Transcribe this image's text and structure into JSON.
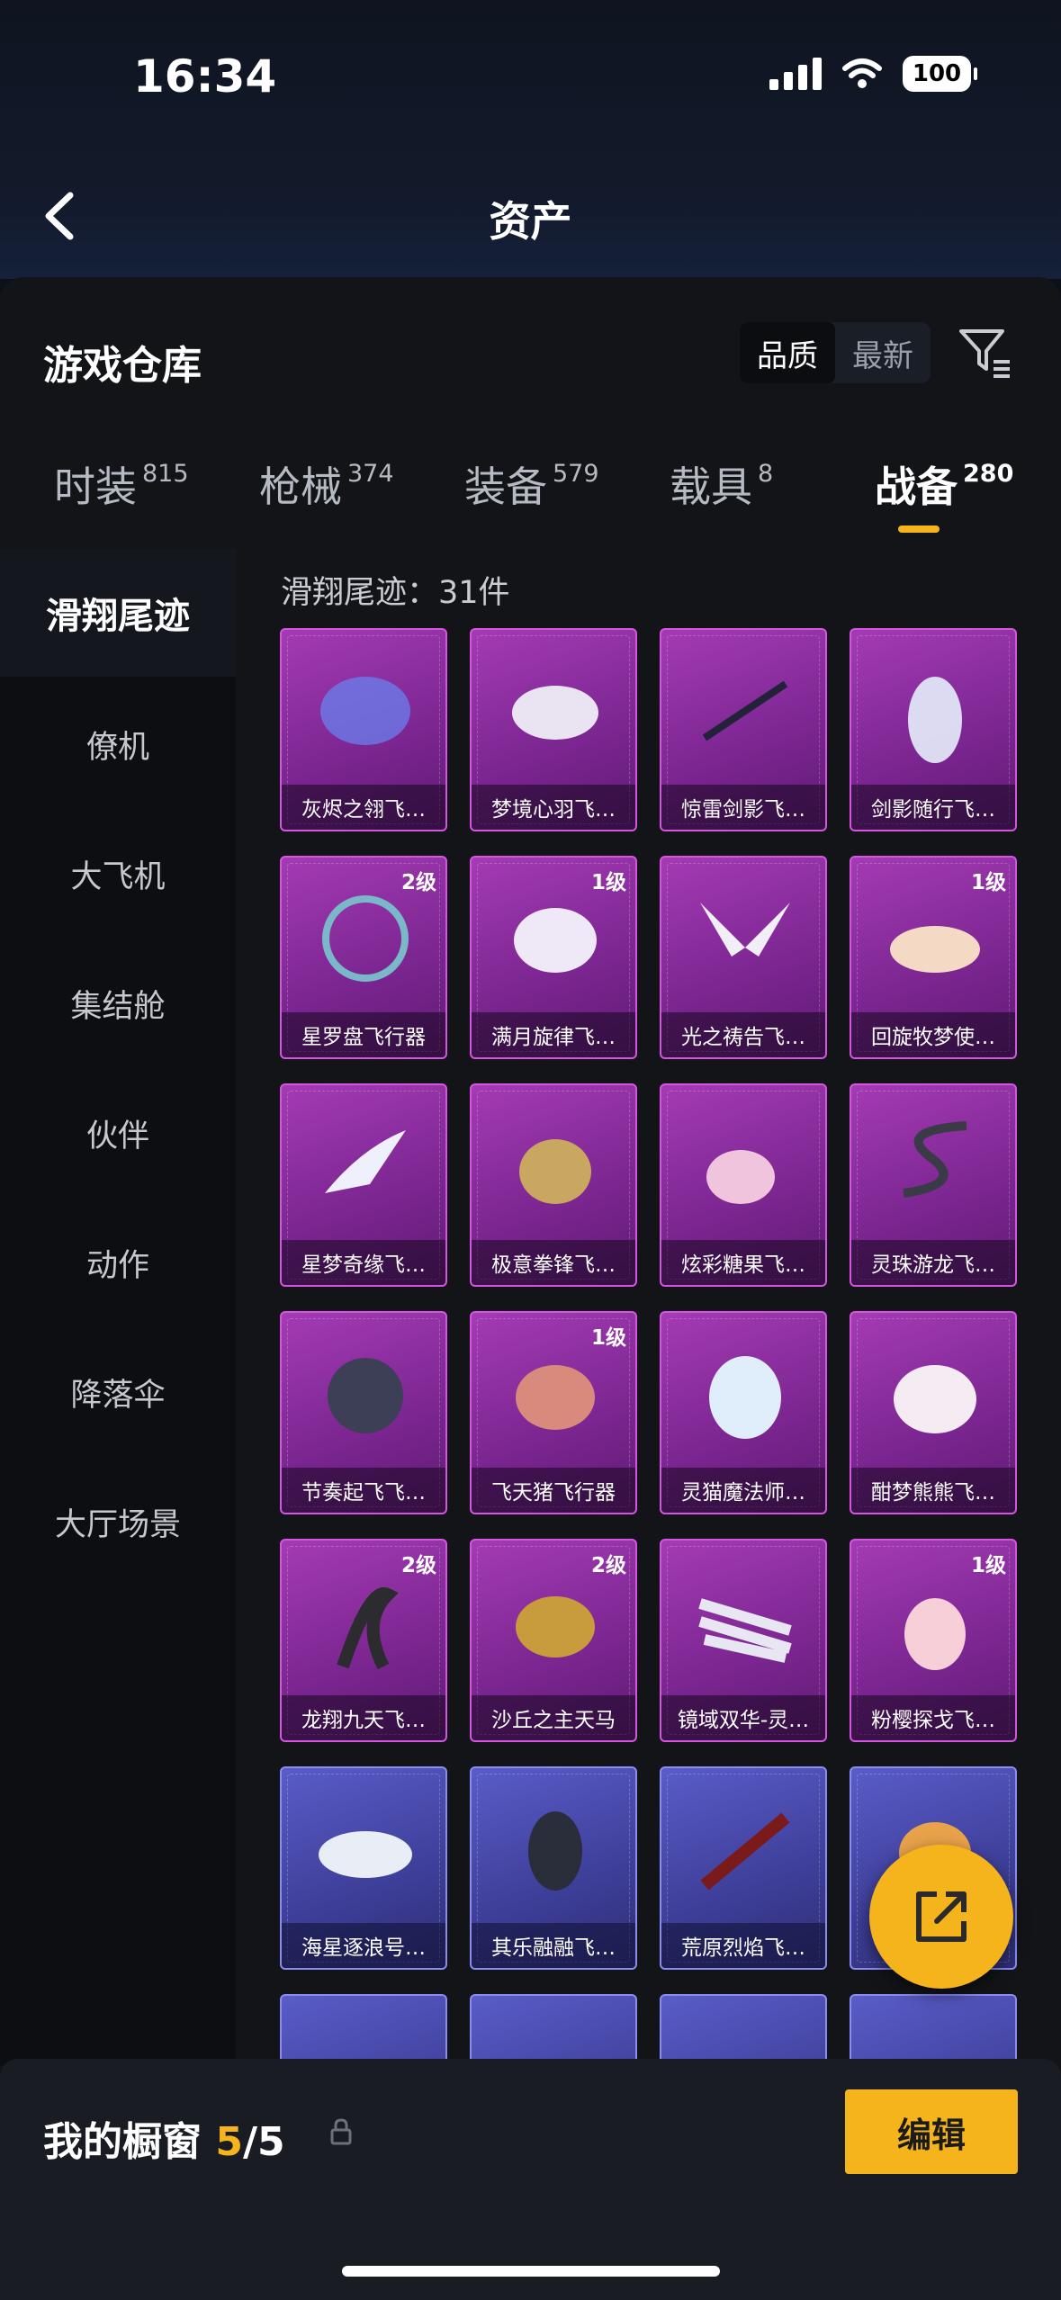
{
  "status": {
    "time": "16:34",
    "battery": "100"
  },
  "nav": {
    "title": "资产"
  },
  "warehouse": {
    "title": "游戏仓库",
    "sort_options": [
      "品质",
      "最新"
    ]
  },
  "tabs": [
    {
      "label": "时装",
      "count": "815"
    },
    {
      "label": "枪械",
      "count": "374"
    },
    {
      "label": "装备",
      "count": "579"
    },
    {
      "label": "载具",
      "count": "8"
    },
    {
      "label": "战备",
      "count": "280"
    }
  ],
  "sidebar": {
    "active": "滑翔尾迹",
    "items": [
      "僚机",
      "大飞机",
      "集结舱",
      "伙伴",
      "动作",
      "降落伞",
      "大厅场景"
    ]
  },
  "content": {
    "count_label": "滑翔尾迹：31件",
    "items": [
      {
        "name": "灰烬之翎飞…",
        "level": ""
      },
      {
        "name": "梦境心羽飞…",
        "level": ""
      },
      {
        "name": "惊雷剑影飞…",
        "level": ""
      },
      {
        "name": "剑影随行飞…",
        "level": ""
      },
      {
        "name": "星罗盘飞行器",
        "level": "2级"
      },
      {
        "name": "满月旋律飞…",
        "level": "1级"
      },
      {
        "name": "光之祷告飞…",
        "level": ""
      },
      {
        "name": "回旋牧梦使…",
        "level": "1级"
      },
      {
        "name": "星梦奇缘飞…",
        "level": ""
      },
      {
        "name": "极意拳锋飞…",
        "level": ""
      },
      {
        "name": "炫彩糖果飞…",
        "level": ""
      },
      {
        "name": "灵珠游龙飞…",
        "level": ""
      },
      {
        "name": "节奏起飞飞…",
        "level": ""
      },
      {
        "name": "飞天猪飞行器",
        "level": "1级"
      },
      {
        "name": "灵猫魔法师…",
        "level": ""
      },
      {
        "name": "酣梦熊熊飞…",
        "level": ""
      },
      {
        "name": "龙翔九天飞…",
        "level": "2级"
      },
      {
        "name": "沙丘之主天马",
        "level": "2级"
      },
      {
        "name": "镜域双华-灵…",
        "level": ""
      },
      {
        "name": "粉樱探戈飞…",
        "level": "1级"
      },
      {
        "name": "海星逐浪号…",
        "level": ""
      },
      {
        "name": "其乐融融飞…",
        "level": ""
      },
      {
        "name": "荒原烈焰飞…",
        "level": ""
      },
      {
        "name": "",
        "level": ""
      }
    ]
  },
  "showcase": {
    "label": "我的橱窗",
    "count": "5",
    "total": "/5",
    "edit_label": "编辑"
  },
  "colors": {
    "accent": "#f6b41c",
    "purple_card": "#a43bb4",
    "blue_card": "#5a5cc8"
  }
}
